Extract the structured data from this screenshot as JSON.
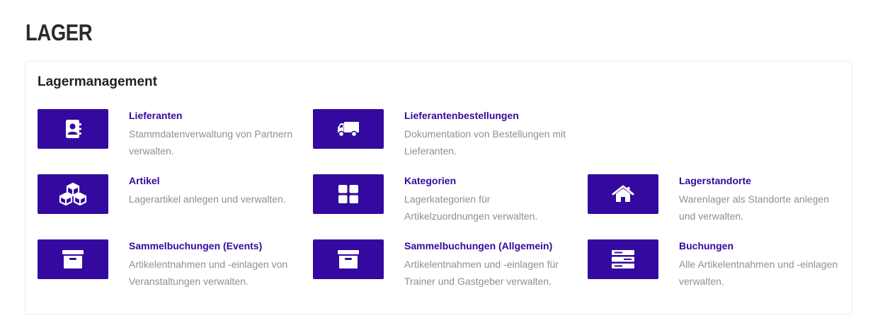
{
  "page": {
    "title": "LAGER"
  },
  "section": {
    "title": "Lagermanagement"
  },
  "colors": {
    "accent": "#33099f",
    "description_text": "#8e8e98",
    "heading_text": "#2b2b2b"
  },
  "tiles": [
    {
      "icon": "contact-book-icon",
      "title": "Lieferanten",
      "description": "Stammdatenverwaltung von Partnern verwalten."
    },
    {
      "icon": "truck-icon",
      "title": "Lieferantenbestellungen",
      "description": "Dokumentation von Bestellungen mit Lieferanten."
    },
    {
      "icon": "cubes-icon",
      "title": "Artikel",
      "description": "Lagerartikel anlegen und verwalten."
    },
    {
      "icon": "grid-icon",
      "title": "Kategorien",
      "description": "Lagerkategorien für Artikelzuordnungen verwalten."
    },
    {
      "icon": "home-icon",
      "title": "Lagerstandorte",
      "description": "Warenlager als Standorte anlegen und verwalten."
    },
    {
      "icon": "archive-box-icon",
      "title": "Sammelbuchungen (Events)",
      "description": "Artikelentnahmen und -einlagen von Veranstaltungen verwalten."
    },
    {
      "icon": "archive-box-icon",
      "title": "Sammelbuchungen (Allgemein)",
      "description": "Artikelentnahmen und -einlagen für Trainer und Gastgeber verwalten."
    },
    {
      "icon": "server-stack-icon",
      "title": "Buchungen",
      "description": "Alle Artikelentnahmen und -einlagen verwalten."
    }
  ]
}
